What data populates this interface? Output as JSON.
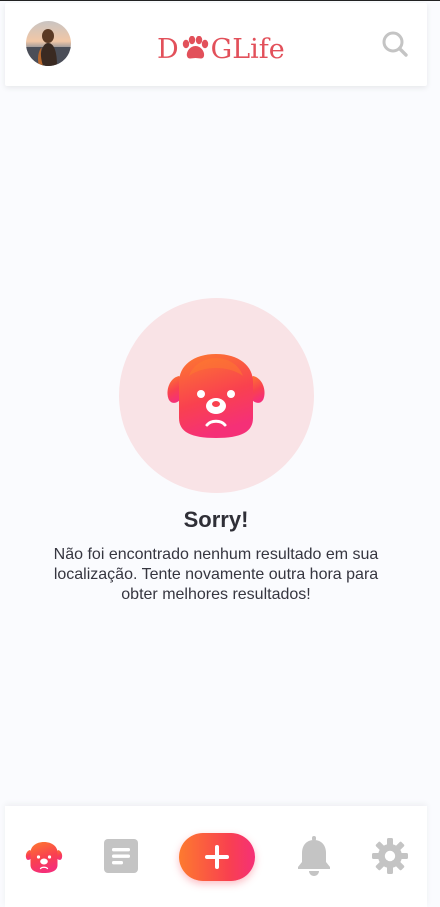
{
  "header": {
    "logo_text_left": "D",
    "logo_text_right": "GLife",
    "avatar_icon": "user-avatar",
    "search_icon": "search-icon"
  },
  "empty_state": {
    "icon": "sad-dog-icon",
    "title": "Sorry!",
    "message": "Não foi encontrado nenhum resultado em sua localização. Tente novamente outra hora para obter melhores resultados!"
  },
  "bottom_nav": {
    "items": [
      {
        "icon": "dog-icon",
        "active": true
      },
      {
        "icon": "feed-icon",
        "active": false
      },
      {
        "icon": "plus-icon",
        "active": false
      },
      {
        "icon": "bell-icon",
        "active": false
      },
      {
        "icon": "gear-icon",
        "active": false
      }
    ]
  },
  "colors": {
    "brand": "#e2505a",
    "gradient_start": "#fd7a2f",
    "gradient_end": "#f53077",
    "empty_circle_bg": "#f9e3e6",
    "inactive_icon": "#c4c4c4",
    "page_bg": "#fafbfe"
  }
}
